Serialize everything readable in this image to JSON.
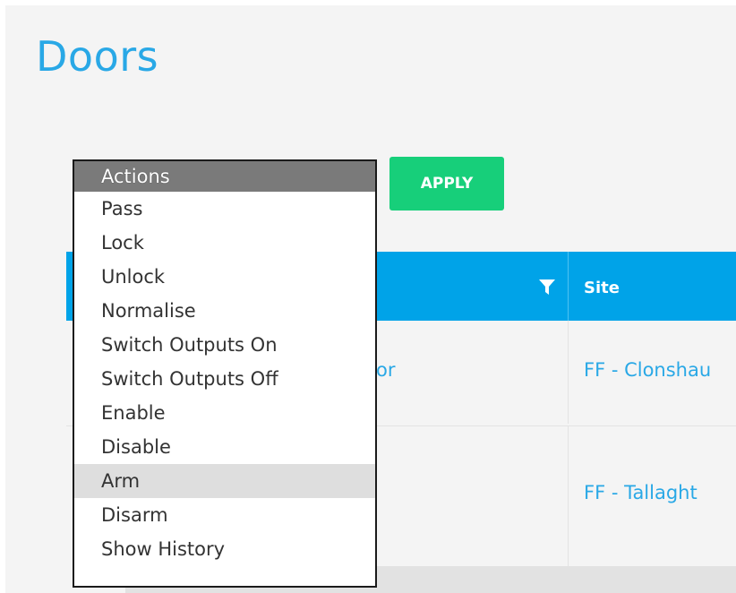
{
  "page": {
    "title": "Doors"
  },
  "toolbar": {
    "apply_label": "APPLY",
    "actions": {
      "selected": "Actions",
      "hovered": "Arm",
      "options": [
        "Actions",
        "Pass",
        "Lock",
        "Unlock",
        "Normalise",
        "Switch Outputs On",
        "Switch Outputs Off",
        "Enable",
        "Disable",
        "Arm",
        "Disarm",
        "Show History"
      ]
    }
  },
  "table": {
    "columns": {
      "site": "Site"
    },
    "rows": [
      {
        "name_tail": "or",
        "site": "FF - Clonshau"
      },
      {
        "name_tail": "",
        "site": "FF - Tallaght"
      }
    ]
  },
  "colors": {
    "title": "#29a8e6",
    "apply": "#17cf7a",
    "header": "#00a3e8",
    "link": "#29a8e6"
  }
}
